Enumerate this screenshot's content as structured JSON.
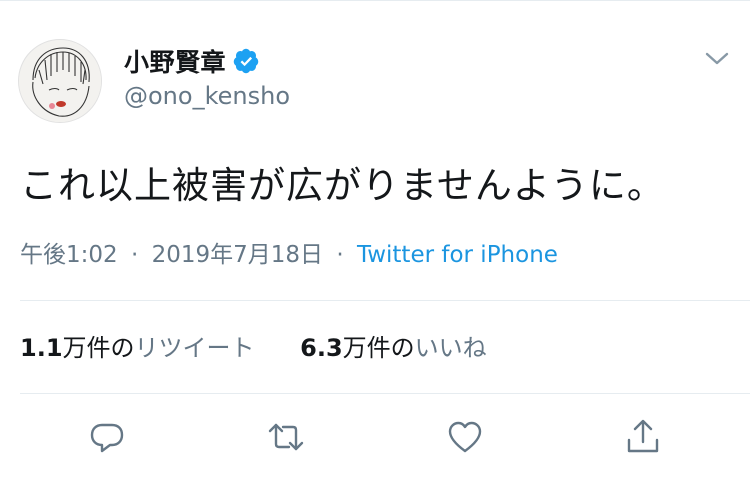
{
  "colors": {
    "text": "#14171a",
    "secondary": "#657786",
    "link": "#1b95e0",
    "verified": "#1da1f2",
    "divider": "#e6ecf0"
  },
  "author": {
    "display_name": "小野賢章",
    "handle": "@ono_kensho",
    "verified": true,
    "avatar_icon": "avatar-drawing",
    "menu_icon": "chevron-down-icon"
  },
  "tweet": {
    "text": "これ以上被害が広がりませんように。",
    "time": "午後1:02",
    "separator": "·",
    "date": "2019年7月18日",
    "source": "Twitter for iPhone"
  },
  "stats": {
    "retweets": {
      "count": "1.1",
      "unit": "万件の",
      "label": "リツイート"
    },
    "likes": {
      "count": "6.3",
      "unit": "万件の",
      "label": "いいね"
    }
  },
  "actions": [
    "reply-icon",
    "retweet-icon",
    "like-icon",
    "share-icon"
  ]
}
